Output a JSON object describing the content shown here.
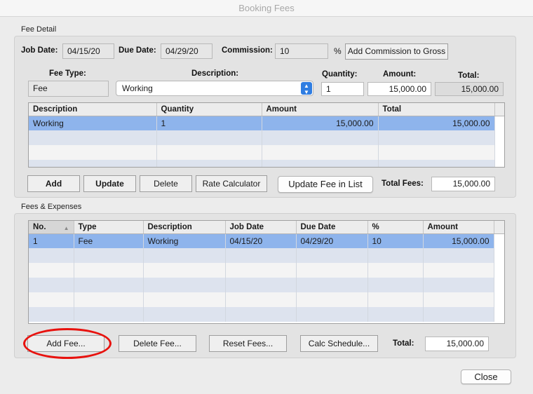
{
  "window": {
    "title": "Booking Fees"
  },
  "fee_detail": {
    "section_label": "Fee Detail",
    "job_date_label": "Job Date:",
    "job_date": "04/15/20",
    "due_date_label": "Due Date:",
    "due_date": "04/29/20",
    "commission_label": "Commission:",
    "commission": "10",
    "percent_sign": "%",
    "add_commission_label": "Add Commission to Gross",
    "fee_type_label": "Fee Type:",
    "fee_type": "Fee",
    "description_label": "Description:",
    "description": "Working",
    "quantity_label": "Quantity:",
    "quantity": "1",
    "amount_label": "Amount:",
    "amount": "15,000.00",
    "total_label": "Total:",
    "total": "15,000.00",
    "table": {
      "columns": [
        "Description",
        "Quantity",
        "Amount",
        "Total"
      ],
      "rows": [
        [
          "Working",
          "1",
          "15,000.00",
          "15,000.00"
        ]
      ]
    },
    "buttons": {
      "add": "Add",
      "update": "Update",
      "delete": "Delete",
      "rate_calculator": "Rate Calculator",
      "update_fee_in_list": "Update Fee in List"
    },
    "total_fees_label": "Total Fees:",
    "total_fees": "15,000.00"
  },
  "fees_expenses": {
    "section_label": "Fees & Expenses",
    "table": {
      "columns": [
        "No.",
        "Type",
        "Description",
        "Job Date",
        "Due Date",
        "%",
        "Amount"
      ],
      "rows": [
        [
          "1",
          "Fee",
          "Working",
          "04/15/20",
          "04/29/20",
          "10",
          "15,000.00"
        ]
      ]
    },
    "buttons": {
      "add_fee": "Add Fee...",
      "delete_fee": "Delete Fee...",
      "reset_fees": "Reset Fees...",
      "calc_schedule": "Calc Schedule..."
    },
    "total_label": "Total:",
    "total": "15,000.00"
  },
  "footer": {
    "close": "Close"
  },
  "colors": {
    "selection": "#8eb4ec",
    "alt_row": "#dde3ee",
    "annotation": "#e8120e",
    "accent": "#2f7de1"
  }
}
